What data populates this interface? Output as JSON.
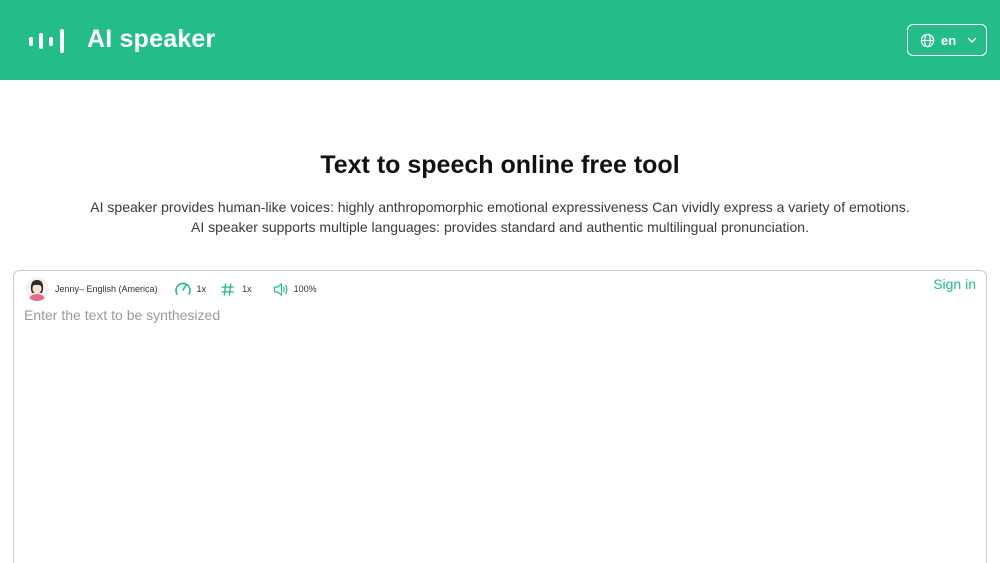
{
  "header": {
    "brand": "AI speaker",
    "logo_icon": "sound-wave-icon",
    "language": {
      "icon": "globe-icon",
      "label": "en",
      "chevron": "chevron-down-icon"
    },
    "bg_color": "#24bd87"
  },
  "hero": {
    "title": "Text to speech online free tool",
    "description_line1": "AI speaker provides human-like voices: highly anthropomorphic emotional expressiveness Can vividly express a variety of emotions.",
    "description_line2": "AI speaker supports multiple languages: provides standard and authentic multilingual pronunciation."
  },
  "editor": {
    "voice": {
      "avatar_icon": "avatar-icon",
      "name": "Jenny– English (America)"
    },
    "speed": {
      "icon": "speedometer-icon",
      "value": "1x"
    },
    "pitch": {
      "icon": "hash-icon",
      "value": "1x"
    },
    "volume": {
      "icon": "speaker-icon",
      "value": "100%"
    },
    "sign_in_label": "Sign in",
    "placeholder": "Enter the text to be synthesized",
    "accent_color": "#24bd87"
  }
}
